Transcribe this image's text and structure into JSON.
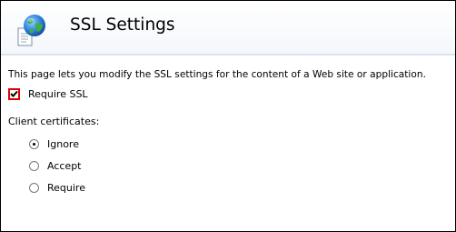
{
  "page": {
    "title": "SSL Settings",
    "description": "This page lets you modify the SSL settings for the content of a Web site or application."
  },
  "require_ssl": {
    "label": "Require SSL",
    "checked": true
  },
  "client_certificates": {
    "label": "Client certificates:",
    "options": [
      {
        "label": "Ignore",
        "selected": true
      },
      {
        "label": "Accept",
        "selected": false
      },
      {
        "label": "Require",
        "selected": false
      }
    ]
  },
  "colors": {
    "checkbox_highlight": "#e00000",
    "header_divider": "#d9e3ef"
  },
  "icons": {
    "header": "globe-document-icon"
  }
}
